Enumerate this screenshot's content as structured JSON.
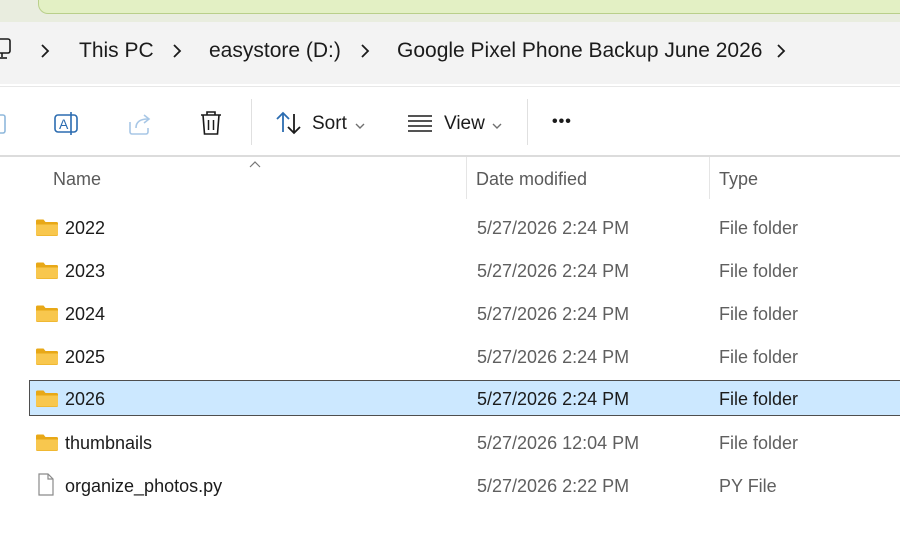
{
  "breadcrumb": {
    "items": [
      "This PC",
      "easystore (D:)",
      "Google Pixel Phone Backup June 2026"
    ]
  },
  "toolbar": {
    "sort_label": "Sort",
    "view_label": "View",
    "more_label": "•••"
  },
  "columns": {
    "name": "Name",
    "date_modified": "Date modified",
    "type": "Type"
  },
  "files": [
    {
      "name": "2022",
      "date": "5/27/2026 2:24 PM",
      "type": "File folder",
      "icon": "folder-icon"
    },
    {
      "name": "2023",
      "date": "5/27/2026 2:24 PM",
      "type": "File folder",
      "icon": "folder-icon"
    },
    {
      "name": "2024",
      "date": "5/27/2026 2:24 PM",
      "type": "File folder",
      "icon": "folder-icon"
    },
    {
      "name": "2025",
      "date": "5/27/2026 2:24 PM",
      "type": "File folder",
      "icon": "folder-icon"
    },
    {
      "name": "2026",
      "date": "5/27/2026 2:24 PM",
      "type": "File folder",
      "icon": "folder-icon",
      "selected": true
    },
    {
      "name": "thumbnails",
      "date": "5/27/2026 12:04 PM",
      "type": "File folder",
      "icon": "folder-icon"
    },
    {
      "name": "organize_photos.py",
      "date": "5/27/2026 2:22 PM",
      "type": "PY File",
      "icon": "file-icon"
    }
  ],
  "colors": {
    "selection": "#cce8ff",
    "folder": "#f8c74e",
    "address_bar": "#f3f3f3"
  }
}
